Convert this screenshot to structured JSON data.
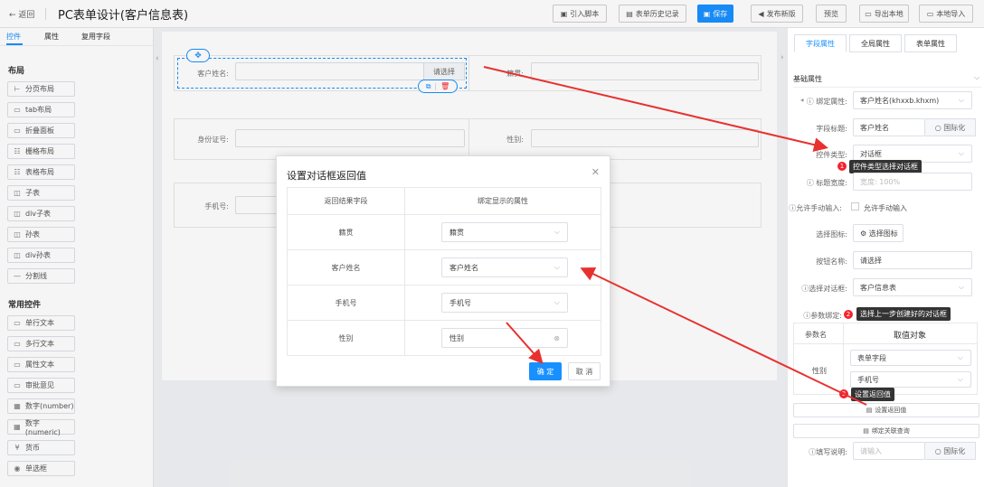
{
  "header": {
    "back_label": "← 返回",
    "title": "PC表单设计(客户信息表)",
    "buttons": {
      "import_script": "引入脚本",
      "history": "表单历史记录",
      "save": "保存",
      "publish": "发布新版",
      "preview": "预览",
      "export": "导出本地",
      "import_local": "本地导入"
    }
  },
  "left_panel": {
    "tabs": [
      "控件",
      "属性",
      "复用字段"
    ],
    "layout_title": "布局",
    "layout_items": [
      "分页布局",
      "tab布局",
      "折叠面板",
      "栅格布局",
      "表格布局",
      "子表",
      "div子表",
      "孙表",
      "div孙表",
      "分割线"
    ],
    "common_title": "常用控件",
    "common_items": [
      "单行文本",
      "多行文本",
      "属性文本",
      "审批意见",
      "数字(number)",
      "数字(numeric)",
      "货币",
      "单选框"
    ]
  },
  "canvas": {
    "customer_name_label": "客户姓名:",
    "select_button": "请选择",
    "native_place_label": "籍贯:",
    "id_card_label": "身份证号:",
    "gender_label": "性别:",
    "phone_label": "手机号:"
  },
  "dialog": {
    "title": "设置对话框返回值",
    "col_result": "返回结果字段",
    "col_bind": "绑定显示的属性",
    "rows": [
      {
        "field": "籍贯",
        "value": "籍贯"
      },
      {
        "field": "客户姓名",
        "value": "客户姓名"
      },
      {
        "field": "手机号",
        "value": "手机号"
      },
      {
        "field": "性别",
        "value": "性别"
      }
    ],
    "confirm": "确 定",
    "cancel": "取 消"
  },
  "right_panel": {
    "tabs": [
      "字段属性",
      "全局属性",
      "表单属性"
    ],
    "section_title": "基础属性",
    "bind_attr_label": "* ⓘ 绑定属性:",
    "bind_attr_value": "客户姓名(khxxb.khxm)",
    "field_title_label": "字段标题:",
    "field_title_value": "客户姓名",
    "i18n_label": "国际化",
    "control_type_label": "控件类型:",
    "control_type_value": "对话框",
    "title_width_label": "ⓘ 标题宽度:",
    "title_width_placeholder": "宽度: 100%",
    "allow_input_label": "ⓘ允许手动输入:",
    "allow_input_text": "允许手动输入",
    "select_icon_label": "选择图标:",
    "select_icon_button": "选择图标",
    "button_name_label": "按钮名称:",
    "button_name_value": "请选择",
    "select_dialog_label": "ⓘ选择对话框:",
    "select_dialog_value": "客户信息表",
    "param_bind_label": "ⓘ参数绑定:",
    "param_col": "参数名",
    "value_col": "取值对象",
    "param_name": "性别",
    "param_source": "表单字段",
    "param_field": "手机号",
    "set_return_button": "设置返回值",
    "bind_query_button": "绑定关联查询",
    "fill_desc_label": "ⓘ填写说明:",
    "fill_desc_placeholder": "请输入"
  },
  "annotations": [
    {
      "num": "1",
      "text": "控件类型选择对话框"
    },
    {
      "num": "2",
      "text": "选择上一步创建好的对话框"
    },
    {
      "num": "3",
      "text": "设置返回值"
    }
  ],
  "colors": {
    "accent": "#1890ff",
    "annotation_red": "#f5222d"
  }
}
